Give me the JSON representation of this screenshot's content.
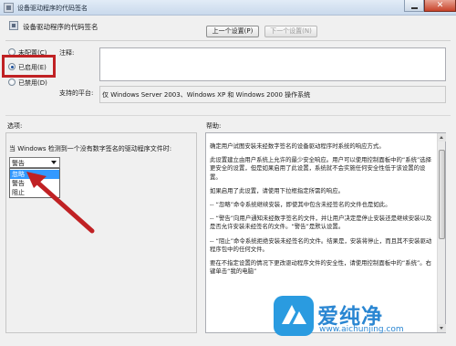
{
  "window": {
    "title": "设备驱动程序的代码签名",
    "close_glyph": "✕"
  },
  "header": {
    "setting_name": "设备驱动程序的代码签名",
    "prev_button": "上一个设置(P)",
    "next_button": "下一个设置(N)"
  },
  "state": {
    "options": [
      {
        "label": "未配置(C)",
        "checked": false
      },
      {
        "label": "已启用(E)",
        "checked": true
      },
      {
        "label": "已禁用(D)",
        "checked": false
      }
    ]
  },
  "comment": {
    "label": "注释:",
    "value": ""
  },
  "supported": {
    "label": "支持的平台:",
    "value": "仅 Windows Server 2003、Windows XP 和 Windows 2000 操作系统"
  },
  "options_section": {
    "label": "选项:",
    "description": "当 Windows 检测到一个没有数字签名的驱动程序文件时:",
    "dropdown_value": "警告",
    "dropdown_options": [
      "忽略",
      "警告",
      "阻止"
    ],
    "highlighted_option": "忽略"
  },
  "help_section": {
    "label": "帮助:",
    "paragraphs": [
      "确定用户试图安装未经数字签名的设备驱动程序时系统的响应方式。",
      "此设置建立由用户系统上允许的最少安全响应。用户可以使用控制面板中的“系统”选择更安全的设置，但是如果启用了此设置，系统就不会实施任何安全性低于该设置的设置。",
      "如果启用了此设置，请使用下拉框指定所需的响应。",
      "-- “忽略”命令系统继续安装，即使其中包含未经签名的文件也是如此。",
      "-- “警告”向用户通知未经数字签名的文件，并让用户决定是停止安装还是继续安装以及是否允许安装未经签名的文件。“警告”是默认设置。",
      "-- “阻止”命令系统拒绝安装未经签名的文件。结果是，安装将停止，而且其不安装驱动程序包中的任何文件。",
      "要在不指定设置的情况下更改驱动程序文件的安全性，请使用控制面板中的“系统”。右键单击“我的电脑”"
    ]
  },
  "watermark": {
    "brand_cn": "爱纯净",
    "url": "www.aichunjing.com"
  },
  "colors": {
    "highlight_box": "#c02124",
    "annotation_arrow": "#c02124",
    "selection": "#3399ff",
    "watermark": "#2a86d2"
  }
}
